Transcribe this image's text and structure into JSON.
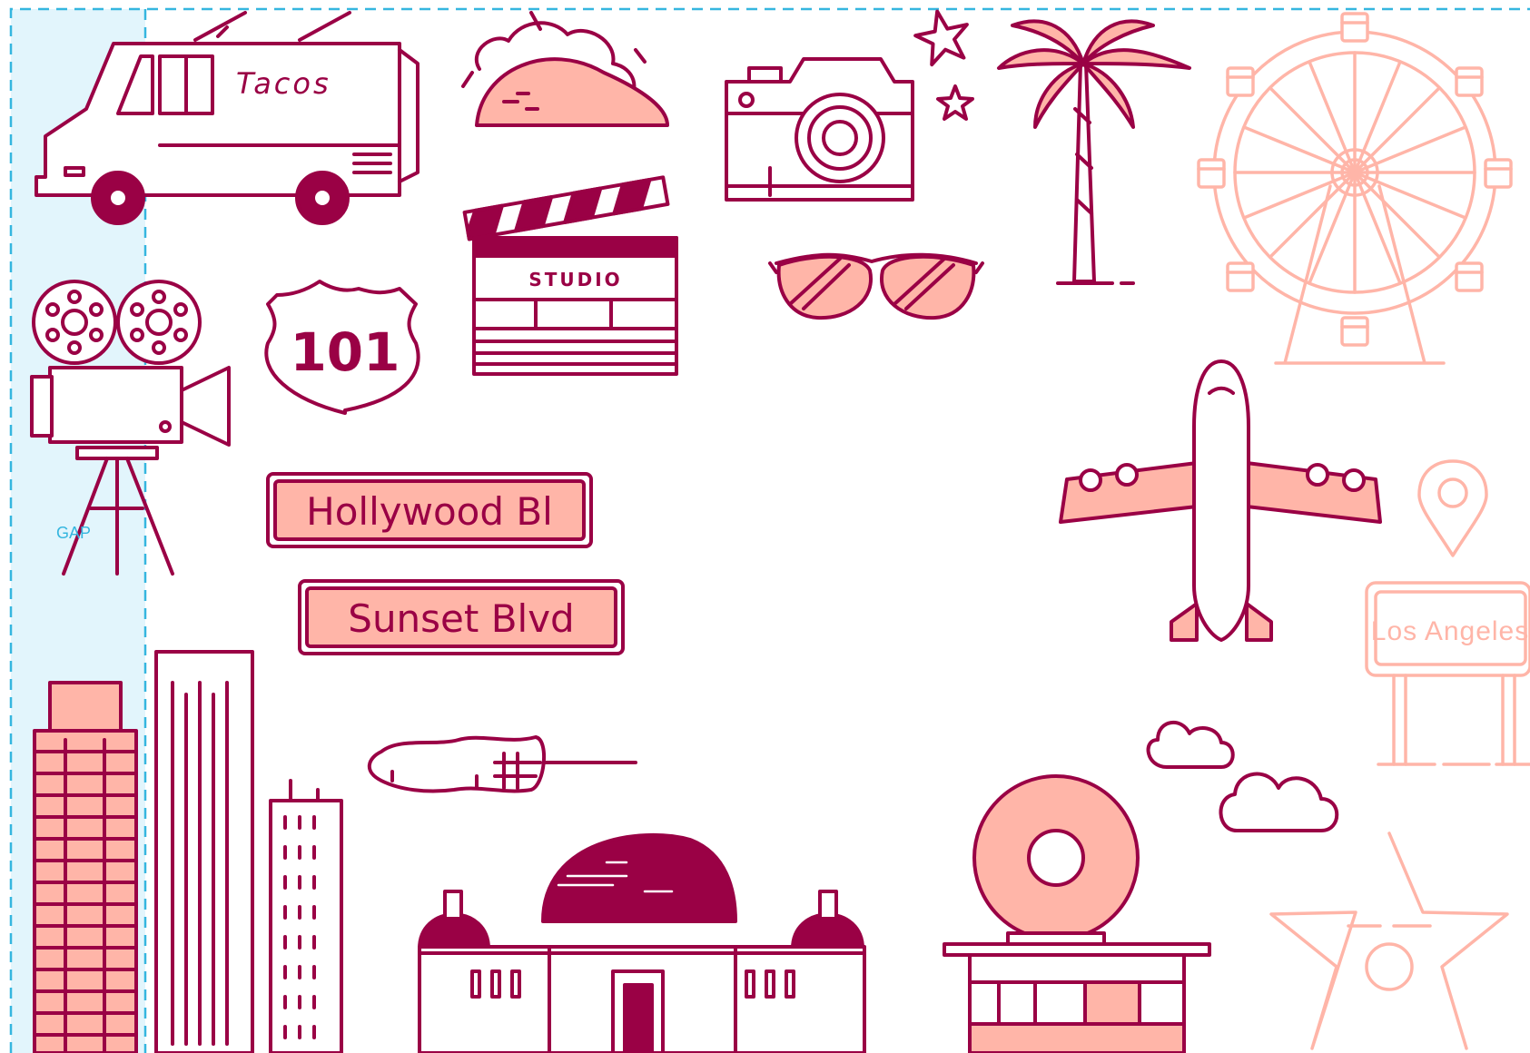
{
  "labels": {
    "tacos": "Tacos",
    "studio": "STUDIO",
    "route": "101",
    "hollywood": "Hollywood Bl",
    "sunset": "Sunset Blvd",
    "los_angeles": "Los Angeles",
    "gap": "GAP"
  },
  "colors": {
    "line": "#9a0145",
    "fill": "#ffb5a8",
    "guide": "#35b6df",
    "gap_fill": "#e2f5fc"
  },
  "icons": [
    "food-truck-icon",
    "taco-icon",
    "camera-icon",
    "stars-icon",
    "palm-tree-icon",
    "ferris-wheel-icon",
    "film-camera-icon",
    "route-shield-icon",
    "clapperboard-icon",
    "sunglasses-icon",
    "airplane-icon",
    "map-pin-icon",
    "street-sign-icon",
    "road-sign-icon",
    "skyscraper-icon",
    "popsicle-icon",
    "observatory-icon",
    "donut-shop-icon",
    "cloud-icon",
    "walk-of-fame-star-icon"
  ]
}
